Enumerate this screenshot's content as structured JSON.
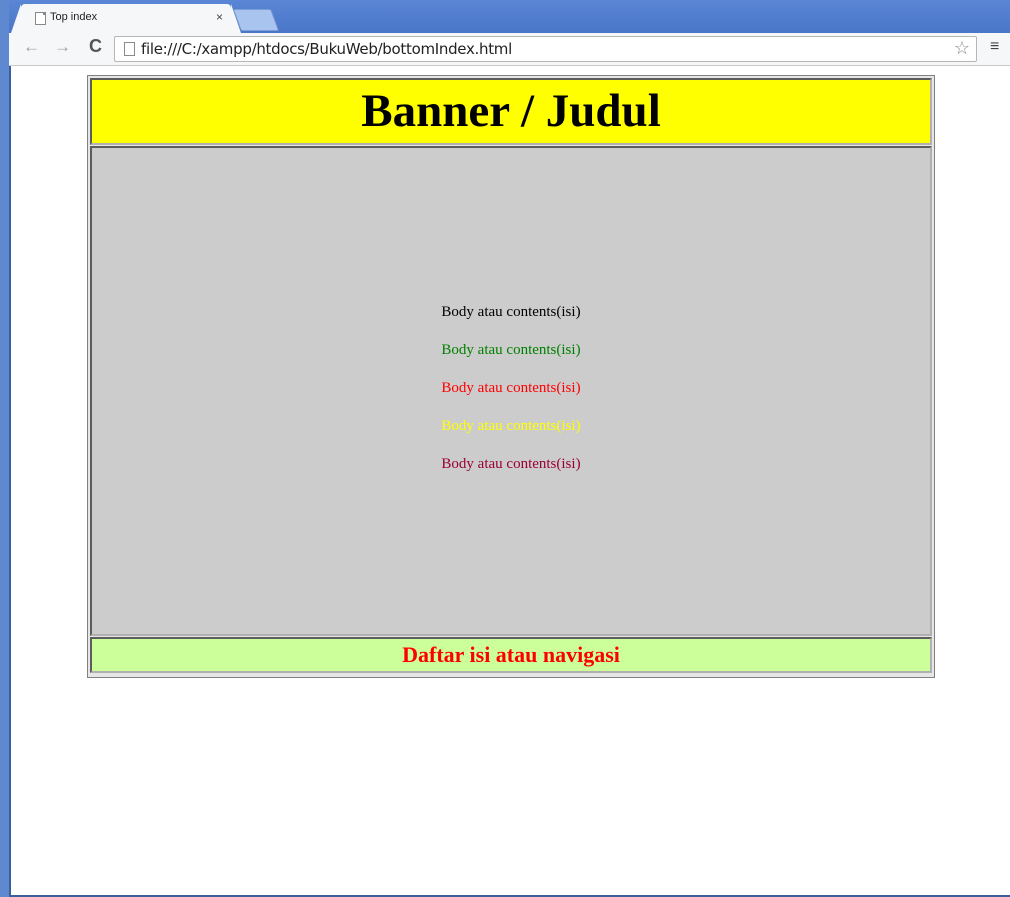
{
  "browser": {
    "tab_title": "Top index",
    "tab_close": "×",
    "url": "file:///C:/xampp/htdocs/BukuWeb/bottomIndex.html",
    "back_icon": "←",
    "forward_icon": "→",
    "reload_icon": "C",
    "star_icon": "☆",
    "menu_icon": "≡"
  },
  "page": {
    "banner": {
      "text": "Banner / Judul",
      "background": "#ffff00"
    },
    "body": {
      "background": "#cccccc",
      "lines": [
        {
          "text": "Body atau contents(isi)",
          "color": "#000000"
        },
        {
          "text": "Body atau contents(isi)",
          "color": "#008000"
        },
        {
          "text": "Body atau contents(isi)",
          "color": "#ff0000"
        },
        {
          "text": "Body atau contents(isi)",
          "color": "#ffff00"
        },
        {
          "text": "Body atau contents(isi)",
          "color": "#990033"
        }
      ]
    },
    "navigation": {
      "text": "Daftar isi atau navigasi",
      "color": "#ff0000",
      "background": "#ccff99"
    }
  }
}
